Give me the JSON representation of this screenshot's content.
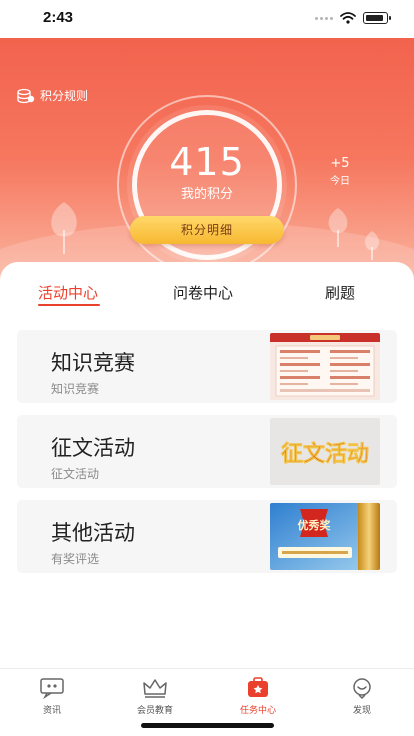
{
  "status_bar": {
    "time": "2:43"
  },
  "header": {
    "rules_label": "积分规则",
    "score": "415",
    "score_label": "我的积分",
    "today_delta": "+5",
    "today_label": "今日",
    "detail_button": "积分明细"
  },
  "tabs": [
    {
      "label": "活动中心",
      "active": true
    },
    {
      "label": "问卷中心",
      "active": false
    },
    {
      "label": "刷题",
      "active": false
    }
  ],
  "cards": [
    {
      "title": "知识竞赛",
      "subtitle": "知识竞赛"
    },
    {
      "title": "征文活动",
      "subtitle": "征文活动",
      "thumb_text": "征文活动"
    },
    {
      "title": "其他活动",
      "subtitle": "有奖评选",
      "thumb_text": "优秀奖"
    }
  ],
  "bottom_nav": [
    {
      "label": "资讯",
      "icon": "news-icon",
      "active": false
    },
    {
      "label": "会员教育",
      "icon": "crown-icon",
      "active": false
    },
    {
      "label": "任务中心",
      "icon": "task-center-icon",
      "active": true
    },
    {
      "label": "发现",
      "icon": "discover-icon",
      "active": false
    }
  ],
  "colors": {
    "brand": "#f15c48",
    "active": "#e9412d",
    "button": "#f7b830"
  }
}
